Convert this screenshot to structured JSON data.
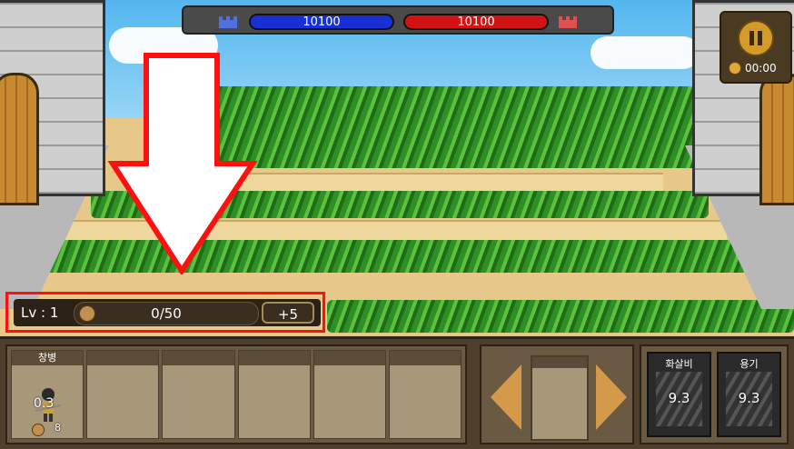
{
  "hud": {
    "ally_hp": "10100",
    "enemy_hp": "10100",
    "timer": "00:00",
    "ally_color": "#1630d6",
    "enemy_color": "#d41414"
  },
  "level_bar": {
    "level_label": "Lv : 1",
    "exp_text": "0/50",
    "plus_label": "+5"
  },
  "units": [
    {
      "name": "창병",
      "cooldown": "0.3",
      "cost": "8"
    },
    {
      "name": "",
      "cooldown": "",
      "cost": ""
    },
    {
      "name": "",
      "cooldown": "",
      "cost": ""
    },
    {
      "name": "",
      "cooldown": "",
      "cost": ""
    },
    {
      "name": "",
      "cooldown": "",
      "cost": ""
    },
    {
      "name": "",
      "cooldown": "",
      "cost": ""
    }
  ],
  "skills": [
    {
      "name": "화살비",
      "cooldown": "9.3"
    },
    {
      "name": "용기",
      "cooldown": "9.3"
    }
  ],
  "icons": {
    "pause": "pause-icon",
    "coin": "coin-icon",
    "arrow": "down-arrow-annotation"
  }
}
